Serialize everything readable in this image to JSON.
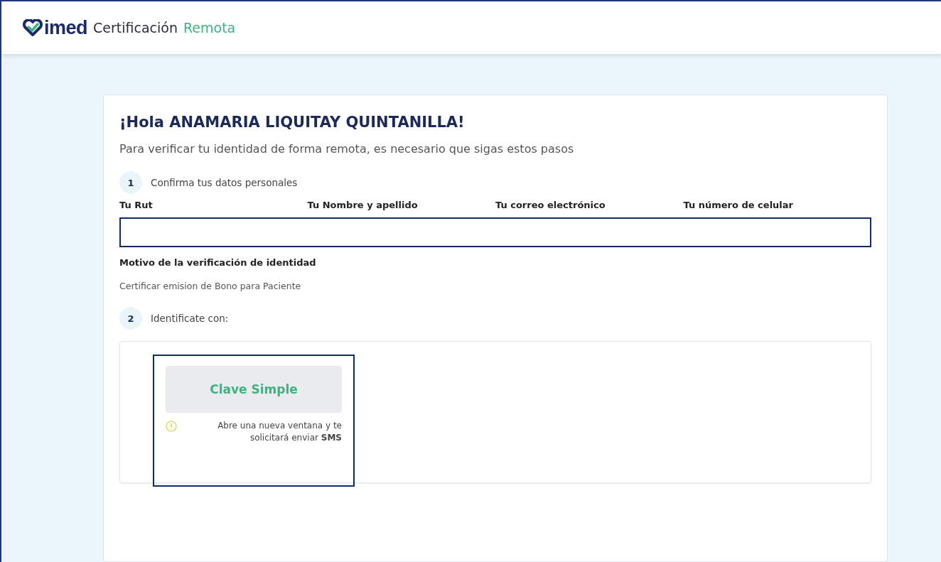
{
  "header": {
    "logo": "imed",
    "title": "Certificación",
    "title_accent": "Remota"
  },
  "greeting": "¡Hola ANAMARIA LIQUITAY QUINTANILLA!",
  "intro": "Para verificar tu identidad de forma remota, es necesario que sigas estos pasos",
  "steps": [
    {
      "number": "1",
      "label": "Confirma tus datos personales"
    },
    {
      "number": "2",
      "label": "Identificate con:"
    }
  ],
  "personal_data": {
    "columns": [
      "Tu Rut",
      "Tu Nombre y apellido",
      "Tu correo electrónico",
      "Tu número de celular"
    ]
  },
  "reason": {
    "label": "Motivo de la verificación de identidad",
    "value": "Certificar emision de Bono para Paciente"
  },
  "login_options": [
    {
      "label": "Clave Simple",
      "note": "Abre una nueva ventana y te solicitará enviar **SMS**",
      "selected": true
    }
  ]
}
